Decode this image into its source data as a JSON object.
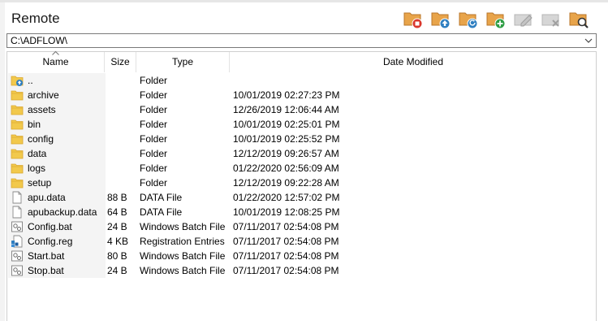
{
  "window": {
    "title": "Remote"
  },
  "toolbar": {
    "buttons": [
      {
        "name": "stop-button",
        "icon": "folder-stop-icon",
        "enabled": true
      },
      {
        "name": "upload-button",
        "icon": "folder-upload-icon",
        "enabled": true
      },
      {
        "name": "refresh-button",
        "icon": "folder-refresh-icon",
        "enabled": true
      },
      {
        "name": "new-folder-button",
        "icon": "folder-add-icon",
        "enabled": true
      },
      {
        "name": "edit-button",
        "icon": "edit-icon",
        "enabled": false
      },
      {
        "name": "delete-button",
        "icon": "delete-icon",
        "enabled": false
      },
      {
        "name": "find-button",
        "icon": "folder-search-icon",
        "enabled": true
      }
    ]
  },
  "path": {
    "value": "C:\\ADFLOW\\"
  },
  "table": {
    "columns": [
      "Name",
      "Size",
      "Type",
      "Date Modified"
    ],
    "sorted_column": "Name",
    "rows": [
      {
        "icon": "folder-up-icon",
        "name": "..",
        "size": "",
        "type": "Folder",
        "date": ""
      },
      {
        "icon": "folder-icon",
        "name": "archive",
        "size": "",
        "type": "Folder",
        "date": "10/01/2019 02:27:23 PM"
      },
      {
        "icon": "folder-icon",
        "name": "assets",
        "size": "",
        "type": "Folder",
        "date": "12/26/2019 12:06:44 AM"
      },
      {
        "icon": "folder-icon",
        "name": "bin",
        "size": "",
        "type": "Folder",
        "date": "10/01/2019 02:25:01 PM"
      },
      {
        "icon": "folder-icon",
        "name": "config",
        "size": "",
        "type": "Folder",
        "date": "10/01/2019 02:25:52 PM"
      },
      {
        "icon": "folder-icon",
        "name": "data",
        "size": "",
        "type": "Folder",
        "date": "12/12/2019 09:26:57 AM"
      },
      {
        "icon": "folder-icon",
        "name": "logs",
        "size": "",
        "type": "Folder",
        "date": "01/22/2020 02:56:09 AM"
      },
      {
        "icon": "folder-icon",
        "name": "setup",
        "size": "",
        "type": "Folder",
        "date": "12/12/2019 09:22:28 AM"
      },
      {
        "icon": "file-icon",
        "name": "apu.data",
        "size": "88 B",
        "type": "DATA File",
        "date": "01/22/2020 12:57:02 PM"
      },
      {
        "icon": "file-icon",
        "name": "apubackup.data",
        "size": "64 B",
        "type": "DATA File",
        "date": "10/01/2019 12:08:25 PM"
      },
      {
        "icon": "batch-file-icon",
        "name": "Config.bat",
        "size": "24 B",
        "type": "Windows Batch File",
        "date": "07/11/2017 02:54:08 PM"
      },
      {
        "icon": "registry-file-icon",
        "name": "Config.reg",
        "size": "4 KB",
        "type": "Registration Entries",
        "date": "07/11/2017 02:54:08 PM"
      },
      {
        "icon": "batch-file-icon",
        "name": "Start.bat",
        "size": "80 B",
        "type": "Windows Batch File",
        "date": "07/11/2017 02:54:08 PM"
      },
      {
        "icon": "batch-file-icon",
        "name": "Stop.bat",
        "size": "24 B",
        "type": "Windows Batch File",
        "date": "07/11/2017 02:54:08 PM"
      }
    ]
  },
  "colors": {
    "folder": "#f2c94c",
    "folder_dark": "#d9a62e",
    "toolbar_folder": "#e8a44a",
    "stop": "#d9362b",
    "upload": "#2f7fc1",
    "add": "#2f9e44",
    "disabled": "#b5b5b5"
  }
}
